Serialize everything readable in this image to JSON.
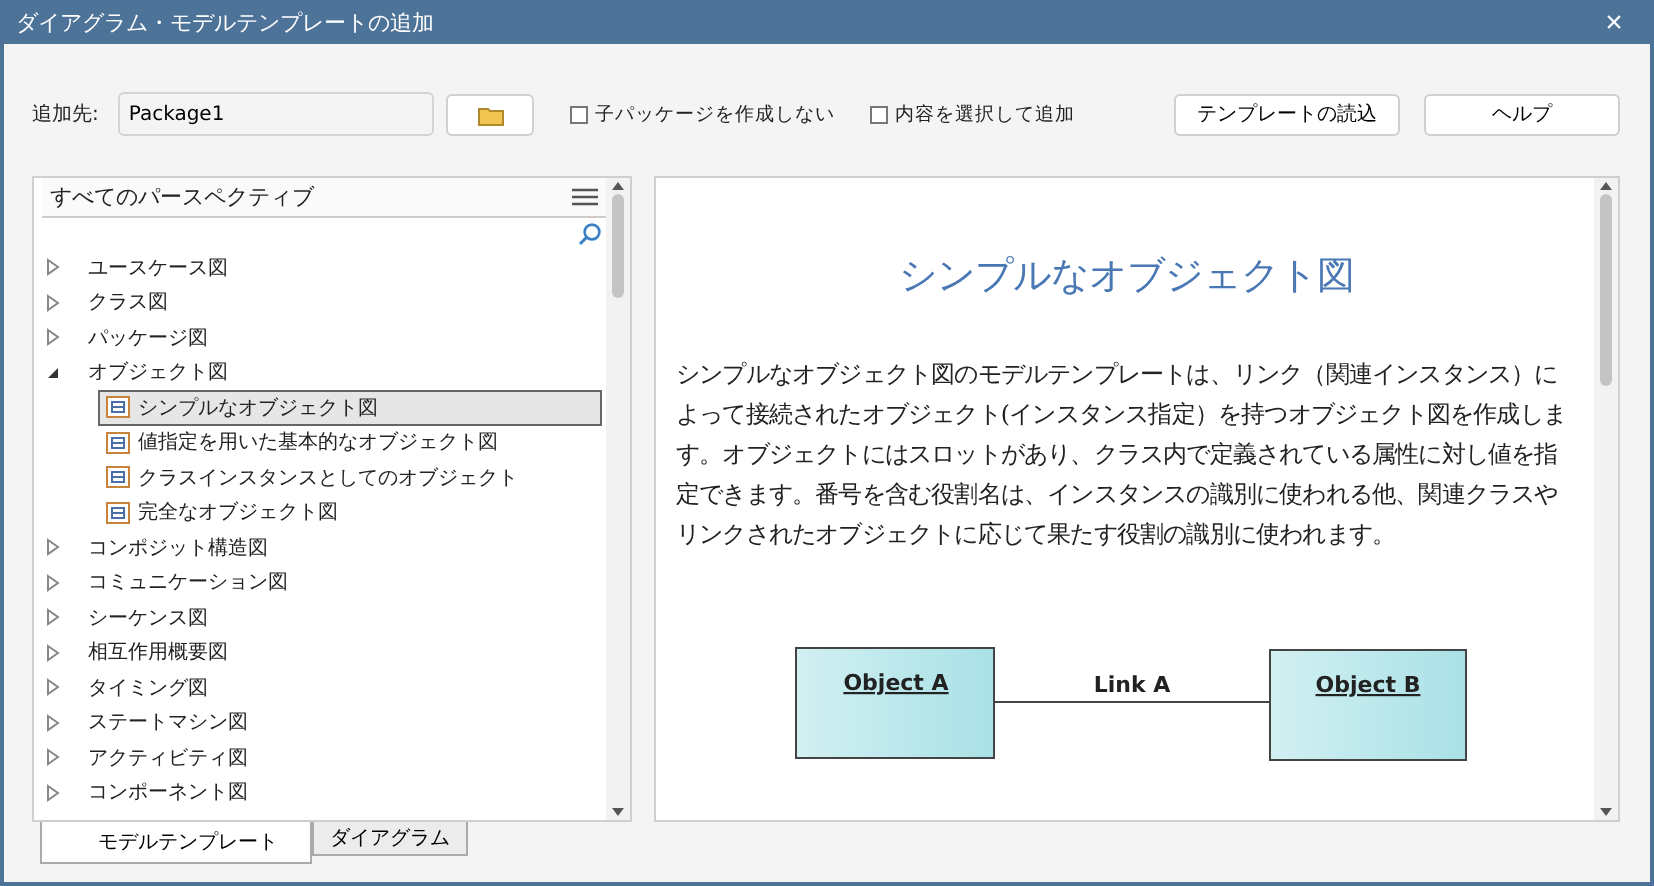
{
  "window": {
    "title": "ダイアグラム・モデルテンプレートの追加",
    "close": "×"
  },
  "toolbar": {
    "target_label": "追加先:",
    "target_value": "Package1",
    "options": [
      {
        "label": "子パッケージを作成しない",
        "checked": false
      },
      {
        "label": "内容を選択して追加",
        "checked": false
      }
    ],
    "buttons": [
      "テンプレートの読込",
      "ヘルプ"
    ]
  },
  "perspective": {
    "title": "すべてのパースペクティブ"
  },
  "tree": [
    {
      "label": "ユースケース図",
      "expanded": false,
      "selected": false
    },
    {
      "label": "クラス図",
      "expanded": false,
      "selected": false
    },
    {
      "label": "パッケージ図",
      "expanded": false,
      "selected": false
    },
    {
      "label": "オブジェクト図",
      "expanded": true,
      "selected": false,
      "children": [
        {
          "label": "シンプルなオブジェクト図",
          "selected": true
        },
        {
          "label": "値指定を用いた基本的なオブジェクト図",
          "selected": false
        },
        {
          "label": "クラスインスタンスとしてのオブジェクト",
          "selected": false
        },
        {
          "label": "完全なオブジェクト図",
          "selected": false
        }
      ]
    },
    {
      "label": "コンポジット構造図",
      "expanded": false,
      "selected": false
    },
    {
      "label": "コミュニケーション図",
      "expanded": false,
      "selected": false
    },
    {
      "label": "シーケンス図",
      "expanded": false,
      "selected": false
    },
    {
      "label": "相互作用概要図",
      "expanded": false,
      "selected": false
    },
    {
      "label": "タイミング図",
      "expanded": false,
      "selected": false
    },
    {
      "label": "ステートマシン図",
      "expanded": false,
      "selected": false
    },
    {
      "label": "アクティビティ図",
      "expanded": false,
      "selected": false
    },
    {
      "label": "コンポーネント図",
      "expanded": false,
      "selected": false
    }
  ],
  "preview": {
    "heading": "シンプルなオブジェクト図",
    "description": "シンプルなオブジェクト図のモデルテンプレートは、リンク（関連インスタンス）によって接続されたオブジェクト(インスタンス指定）を持つオブジェクト図を作成します。オブジェクトにはスロットがあり、クラス内で定義されている属性に対し値を指定できます。番号を含む役割名は、インスタンスの識別に使われる他、関連クラスやリンクされたオブジェクトに応じて果たす役割の識別に使われます。",
    "diagram": {
      "nodes": [
        "Object A",
        "Object B"
      ],
      "link": "Link A"
    }
  },
  "tabs": [
    {
      "label": "モデルテンプレート",
      "selected": true
    },
    {
      "label": "ダイアグラム",
      "selected": false
    }
  ]
}
